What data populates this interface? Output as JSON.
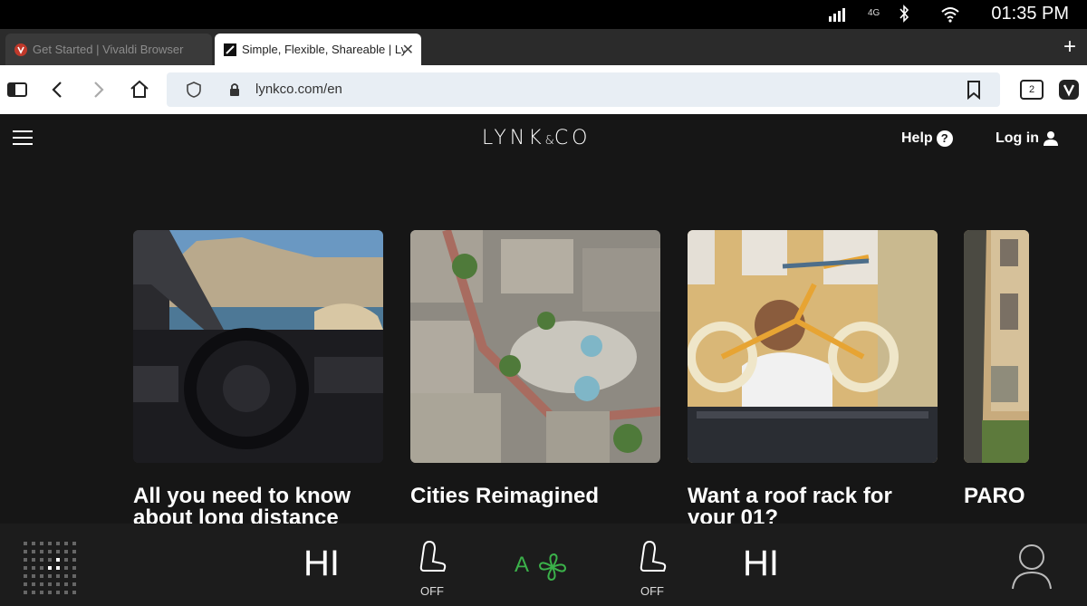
{
  "status_bar": {
    "clock": "01:35 PM",
    "network": "4G"
  },
  "tabs": [
    {
      "title": "Get Started | Vivaldi Browser",
      "active": false
    },
    {
      "title": "Simple, Flexible, Shareable | Lynk",
      "active": true
    }
  ],
  "toolbar": {
    "url": "lynkco.com/en",
    "tab_count": "2"
  },
  "site": {
    "logo": "LYNK",
    "logo_amp": "&",
    "logo_tail": "CO",
    "help_label": "Help",
    "login_label": "Log in"
  },
  "cards": [
    {
      "title": "All you need to know about long distance"
    },
    {
      "title": "Cities Reimagined"
    },
    {
      "title": "Want a roof rack for your 01?"
    },
    {
      "title": "PARO S"
    }
  ],
  "car_bar": {
    "left_temp": "HI",
    "right_temp": "HI",
    "left_seat_status": "OFF",
    "right_seat_status": "OFF",
    "climate_mode": "A"
  },
  "colors": {
    "climate_accent": "#3bb14a",
    "page_bg": "#161616"
  }
}
